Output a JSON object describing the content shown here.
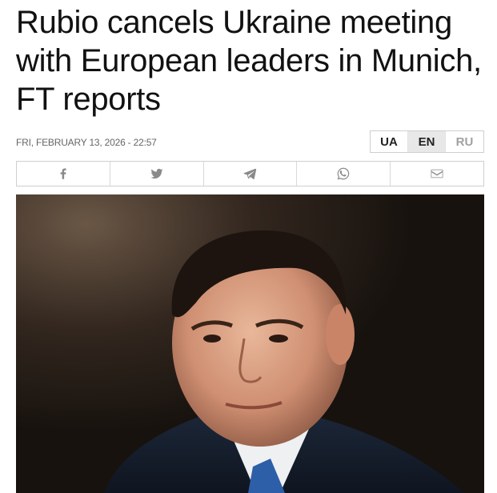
{
  "article": {
    "headline": "Rubio cancels Ukraine meeting with European leaders in Munich, FT reports",
    "dateline": "FRI, FEBRUARY 13, 2026 - 22:57"
  },
  "languages": [
    {
      "code": "UA",
      "active": false
    },
    {
      "code": "EN",
      "active": true
    },
    {
      "code": "RU",
      "active": false
    }
  ],
  "share": [
    {
      "icon": "facebook-icon"
    },
    {
      "icon": "twitter-icon"
    },
    {
      "icon": "telegram-icon"
    },
    {
      "icon": "whatsapp-icon"
    },
    {
      "icon": "email-icon"
    }
  ],
  "photo": {
    "subject": "portrait"
  },
  "colors": {
    "text": "#111111",
    "meta": "#666666",
    "border": "#cfcfcf",
    "active_lang_bg": "#e8e8e8",
    "inactive_lang": "#a0a0a0",
    "icon": "#8a8a8a"
  }
}
